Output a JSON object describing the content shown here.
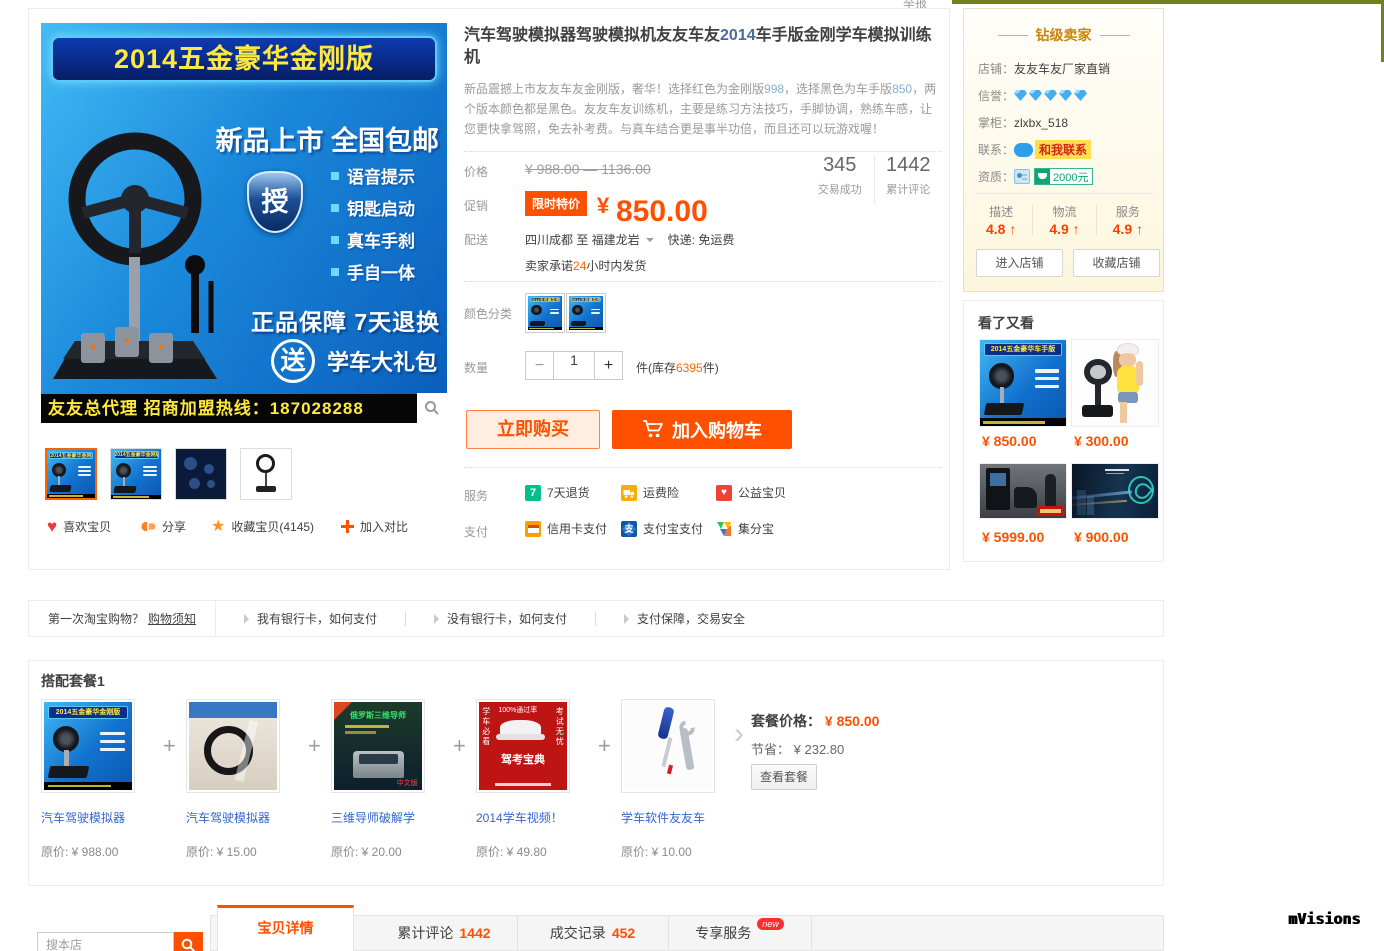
{
  "page": {
    "report": "举报",
    "watermark": "mVisions",
    "accent": "#ff5000",
    "link_blue": "#3366cc",
    "seller_gold": "#c8860a",
    "olive_edge": "#72801e"
  },
  "gallery": {
    "banner": "2014五金豪华金刚版",
    "headline": "新品上市 全国包邮",
    "shield_glyph": "授",
    "features": [
      "语音提示",
      "钥匙启动",
      "真车手刹",
      "手自一体"
    ],
    "guarantee": "正品保障 7天退换",
    "gift_glyph": "送",
    "gift_text": "学车大礼包",
    "hotline": "友友总代理 招商加盟热线：187028288"
  },
  "actions": {
    "like": "喜欢宝贝",
    "share": "分享",
    "favorite": "收藏宝贝(4145)",
    "compare": "加入对比"
  },
  "product": {
    "title_pre": "汽车驾驶模拟器驾驶模拟机友友车友",
    "title_num": "2014",
    "title_post": "车手版金刚学车模拟训练机",
    "desc_1": "新品震撼上市友友车友金刚版，奢华！选择红色为金刚版",
    "desc_num1": "998",
    "desc_2": "，选择黑色为车手版",
    "desc_num2": "850",
    "desc_3": "，两个版本颜色都是黑色。友友车友训练机，主要是练习方法技巧，手脚协调，熟练车感，让您更快拿驾照，免去补考费。与真车结合更是事半功倍，而且还可以玩游戏喔！"
  },
  "price": {
    "label": "价格",
    "original": "¥ 988.00 — 1136.00",
    "promo_label": "促销",
    "promo_badge": "限时特价",
    "currency": "¥",
    "promo_value": "850.00"
  },
  "stats": [
    {
      "value": "345",
      "label": "交易成功"
    },
    {
      "value": "1442",
      "label": "累计评论"
    }
  ],
  "shipping": {
    "label": "配送",
    "route": "四川成都  至  福建龙岩",
    "express_label": "快递:",
    "express_value": "免运费",
    "promise_pre": "卖家承诺",
    "promise_num": "24",
    "promise_post": "小时内发货"
  },
  "sku": {
    "label": "颜色分类"
  },
  "quantity": {
    "label": "数量",
    "minus": "−",
    "value": "1",
    "plus": "+",
    "stock_pre": "件(库存",
    "stock_num": "6395",
    "stock_post": "件)"
  },
  "buy": {
    "buy_now": "立即购买",
    "add_cart": "加入购物车"
  },
  "services": {
    "label": "服务",
    "items": [
      {
        "label": "7天退货",
        "icon_glyph": "7"
      },
      {
        "label": "运费险"
      },
      {
        "label": "公益宝贝",
        "icon_glyph": "♥"
      }
    ]
  },
  "payments": {
    "label": "支付",
    "items": [
      {
        "label": "信用卡支付"
      },
      {
        "label": "支付宝支付",
        "icon_glyph": "支"
      },
      {
        "label": "集分宝"
      }
    ]
  },
  "seller": {
    "header": "钻级卖家",
    "shop_label": "店铺：",
    "shop": "友友车友厂家直销",
    "credit_label": "信誉：",
    "owner_label": "掌柜：",
    "owner": "zlxbx_518",
    "contact_label": "联系：",
    "contact_badge": "和我联系",
    "cert_label": "资质：",
    "cert_money": "2000元",
    "arrow": "↑",
    "ratings": [
      {
        "label": "描述",
        "value": "4.8"
      },
      {
        "label": "物流",
        "value": "4.9"
      },
      {
        "label": "服务",
        "value": "4.9"
      }
    ],
    "enter_shop": "进入店铺",
    "fav_shop": "收藏店铺"
  },
  "also_viewed": {
    "title": "看了又看",
    "items": [
      {
        "price": "¥ 850.00",
        "img_banner": "2014五金豪华车手版"
      },
      {
        "price": "¥ 300.00"
      },
      {
        "price": "¥ 5999.00"
      },
      {
        "price": "¥ 900.00"
      }
    ]
  },
  "faq": {
    "q_text": "第一次淘宝购物？",
    "q_link": "购物须知",
    "items": [
      "我有银行卡，如何支付",
      "没有银行卡，如何支付",
      "支付保障，交易安全"
    ]
  },
  "bundle": {
    "title": "搭配套餐1",
    "plus": "+",
    "items": [
      {
        "name": "汽车驾驶模拟器",
        "price_label": "原价: ",
        "price": "¥ 988.00"
      },
      {
        "name": "汽车驾驶模拟器",
        "price_label": "原价: ",
        "price": "¥ 15.00"
      },
      {
        "name": "三维导师破解学",
        "price_label": "原价: ",
        "price": "¥ 20.00",
        "img_title": "俄罗斯三维导师",
        "img_caption": "中文版"
      },
      {
        "name": "2014学车视频！",
        "price_label": "原价: ",
        "price": "¥ 49.80",
        "img_left": "学车必看",
        "img_top": "100%通过率",
        "img_right": "考试无忧",
        "img_center": "驾考宝典"
      },
      {
        "name": "学车软件友友车",
        "price_label": "原价: ",
        "price": "¥ 10.00"
      }
    ],
    "price_label": "套餐价格：",
    "price": "¥ 850.00",
    "save_label": "节省：",
    "save": "¥ 232.80",
    "view_button": "查看套餐"
  },
  "tabs": {
    "search_placeholder": "搜本店",
    "items": [
      {
        "label": "宝贝详情"
      },
      {
        "label": "累计评论",
        "count": "1442"
      },
      {
        "label": "成交记录",
        "count": "452"
      },
      {
        "label": "专享服务",
        "badge": "new"
      }
    ]
  }
}
